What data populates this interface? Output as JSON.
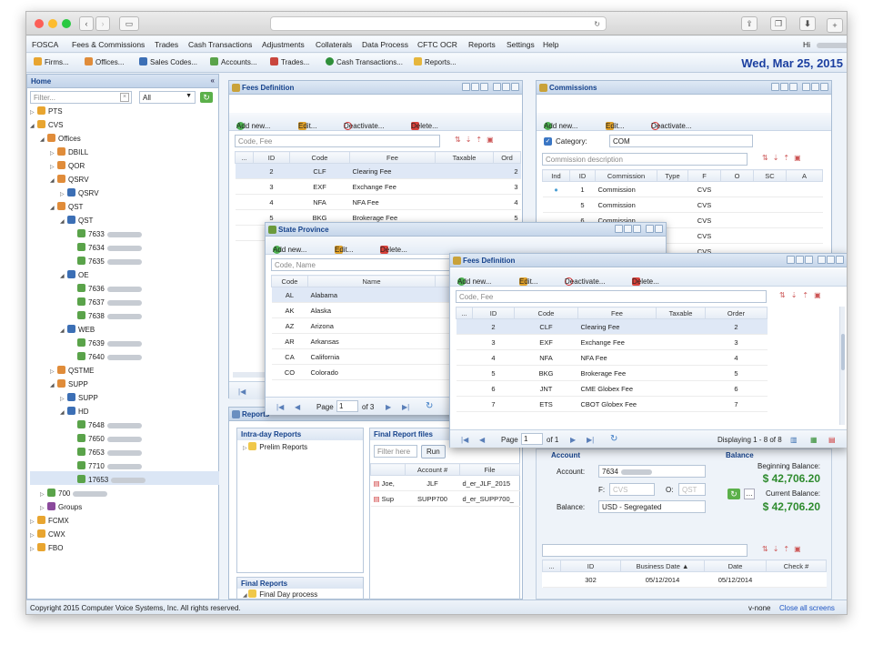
{
  "browser": {
    "url": "",
    "title": ""
  },
  "menu": [
    "FOSCA",
    "Fees & Commissions",
    "Trades",
    "Cash Transactions",
    "Adjustments",
    "Collaterals",
    "Data Process",
    "CFTC OCR",
    "Reports",
    "Settings",
    "Help"
  ],
  "greeting": "Hi",
  "toolbar": {
    "items": [
      "Firms...",
      "Offices...",
      "Sales Codes...",
      "Accounts...",
      "Trades...",
      "Cash Transactions...",
      "Reports..."
    ],
    "date": "Wed, Mar 25, 2015"
  },
  "home": {
    "title": "Home",
    "filter_placeholder": "Filter...",
    "filter_select": "All",
    "tree": [
      {
        "label": "PTS",
        "toggle": "▷"
      },
      {
        "label": "CVS",
        "toggle": "◢"
      },
      {
        "label": "Offices",
        "toggle": "◢"
      },
      {
        "label": "DBILL",
        "toggle": "▷"
      },
      {
        "label": "QOR",
        "toggle": "▷"
      },
      {
        "label": "QSRV",
        "toggle": "◢"
      },
      {
        "label": "QSRV",
        "toggle": "▷"
      },
      {
        "label": "QST",
        "toggle": "◢"
      },
      {
        "label": "QST",
        "toggle": "◢"
      },
      {
        "label": "7633",
        "toggle": ""
      },
      {
        "label": "7634",
        "toggle": ""
      },
      {
        "label": "7635",
        "toggle": ""
      },
      {
        "label": "OE",
        "toggle": "◢"
      },
      {
        "label": "7636",
        "toggle": ""
      },
      {
        "label": "7637",
        "toggle": ""
      },
      {
        "label": "7638",
        "toggle": ""
      },
      {
        "label": "WEB",
        "toggle": "◢"
      },
      {
        "label": "7639",
        "toggle": ""
      },
      {
        "label": "7640",
        "toggle": ""
      },
      {
        "label": "QSTME",
        "toggle": "▷"
      },
      {
        "label": "SUPP",
        "toggle": "◢"
      },
      {
        "label": "SUPP",
        "toggle": "▷"
      },
      {
        "label": "HD",
        "toggle": "◢"
      },
      {
        "label": "7648",
        "toggle": ""
      },
      {
        "label": "7650",
        "toggle": ""
      },
      {
        "label": "7653",
        "toggle": ""
      },
      {
        "label": "7710",
        "toggle": ""
      },
      {
        "label": "17653",
        "toggle": ""
      },
      {
        "label": "700",
        "toggle": "▷"
      },
      {
        "label": "Groups",
        "toggle": "▷"
      },
      {
        "label": "FCMX",
        "toggle": "▷"
      },
      {
        "label": "CWX",
        "toggle": "▷"
      },
      {
        "label": "FBO",
        "toggle": "▷"
      }
    ]
  },
  "fees": {
    "title": "Fees Definition",
    "add": "Add new...",
    "edit": "Edit...",
    "deactivate": "Deactivate...",
    "delete": "Delete...",
    "search_placeholder": "Code, Fee",
    "headers": [
      "...",
      "ID",
      "Code",
      "Fee",
      "Taxable",
      "Ord"
    ],
    "rows": [
      [
        "2",
        "CLF",
        "Clearing Fee",
        "2"
      ],
      [
        "3",
        "EXF",
        "Exchange Fee",
        "3"
      ],
      [
        "4",
        "NFA",
        "NFA Fee",
        "4"
      ],
      [
        "5",
        "BKG",
        "Brokerage Fee",
        "5"
      ],
      [
        "6",
        "JNT",
        "CME Globex Fee",
        "6"
      ]
    ]
  },
  "commissions": {
    "title": "Commissions",
    "add": "Add new...",
    "edit": "Edit...",
    "deactivate": "Deactivate...",
    "category_label": "Category:",
    "category_value": "COM",
    "desc_placeholder": "Commission description",
    "headers": [
      "Ind",
      "ID",
      "Commission",
      "Type",
      "F",
      "O",
      "SC",
      "A"
    ],
    "rows": [
      [
        "1",
        "Commission",
        "CVS"
      ],
      [
        "5",
        "Commission",
        "CVS"
      ],
      [
        "6",
        "Commission",
        "CVS"
      ],
      [
        "",
        "",
        "CVS"
      ],
      [
        "",
        "",
        "CVS"
      ]
    ]
  },
  "state": {
    "title": "State Province",
    "add": "Add new...",
    "edit": "Edit...",
    "delete": "Delete...",
    "search_placeholder": "Code, Name",
    "headers": [
      "Code",
      "Name",
      "Co"
    ],
    "rows": [
      [
        "AL",
        "Alabama"
      ],
      [
        "AK",
        "Alaska"
      ],
      [
        "AZ",
        "Arizona"
      ],
      [
        "AR",
        "Arkansas"
      ],
      [
        "CA",
        "California"
      ],
      [
        "CO",
        "Colorado"
      ]
    ],
    "page_label": "Page",
    "page": "1",
    "of": "of 3"
  },
  "fees2": {
    "title": "Fees Definition",
    "add": "Add new...",
    "edit": "Edit...",
    "deactivate": "Deactivate...",
    "delete": "Delete...",
    "search_placeholder": "Code, Fee",
    "headers": [
      "...",
      "ID",
      "Code",
      "Fee",
      "Taxable",
      "Order"
    ],
    "rows": [
      [
        "2",
        "CLF",
        "Clearing Fee",
        "2"
      ],
      [
        "3",
        "EXF",
        "Exchange Fee",
        "3"
      ],
      [
        "4",
        "NFA",
        "NFA Fee",
        "4"
      ],
      [
        "5",
        "BKG",
        "Brokerage Fee",
        "5"
      ],
      [
        "6",
        "JNT",
        "CME Globex Fee",
        "6"
      ],
      [
        "7",
        "ETS",
        "CBOT Globex Fee",
        "7"
      ]
    ],
    "page_label": "Page",
    "page": "1",
    "of": "of 1",
    "displaying": "Displaying 1 - 8 of 8"
  },
  "reports": {
    "title": "Reports",
    "intraday_title": "Intra-day Reports",
    "intraday_item": "Prelim Reports",
    "final_files_title": "Final Report files",
    "filter_placeholder": "Filter here",
    "run": "Run",
    "headers": [
      "",
      "Account #",
      "File"
    ],
    "rows": [
      [
        "Joe,",
        "JLF",
        "d_er_JLF_2015"
      ],
      [
        "Sup",
        "SUPP700",
        "d_er_SUPP700_"
      ]
    ],
    "final_title": "Final Reports",
    "final_item": "Final Day process"
  },
  "account": {
    "section": "Account",
    "account_label": "Account:",
    "account_value": "7634",
    "f_label": "F:",
    "f_value": "CVS",
    "o_label": "O:",
    "o_value": "QST",
    "balance_label": "Balance:",
    "balance_value": "USD - Segregated",
    "balance_section": "Balance",
    "beginning_label": "Beginning Balance:",
    "beginning_value": "$ 42,706.20",
    "current_label": "Current Balance:",
    "current_value": "$ 42,706.20",
    "grid_headers": [
      "...",
      "ID",
      "Business Date ▲",
      "Date",
      "Check #"
    ],
    "grid_row": [
      "302",
      "05/12/2014",
      "05/12/2014"
    ]
  },
  "footer": {
    "copyright": "Copyright 2015 Computer Voice Systems, Inc. All rights reserved.",
    "user": "v-none",
    "close_all": "Close all screens"
  }
}
